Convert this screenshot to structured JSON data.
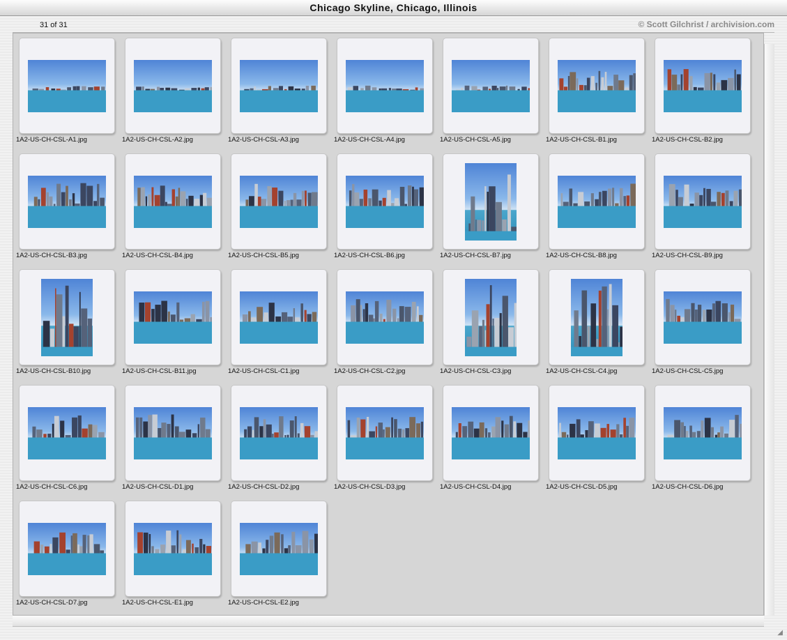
{
  "window": {
    "title": "Chicago Skyline, Chicago, Illinois"
  },
  "header": {
    "count": "31 of 31",
    "copyright": "© Scott Gilchrist / archivision.com"
  },
  "images": [
    {
      "file": "1A2-US-CH-CSL-A1.jpg",
      "orientation": "landscape"
    },
    {
      "file": "1A2-US-CH-CSL-A2.jpg",
      "orientation": "landscape"
    },
    {
      "file": "1A2-US-CH-CSL-A3.jpg",
      "orientation": "landscape"
    },
    {
      "file": "1A2-US-CH-CSL-A4.jpg",
      "orientation": "landscape"
    },
    {
      "file": "1A2-US-CH-CSL-A5.jpg",
      "orientation": "landscape"
    },
    {
      "file": "1A2-US-CH-CSL-B1.jpg",
      "orientation": "landscape"
    },
    {
      "file": "1A2-US-CH-CSL-B2.jpg",
      "orientation": "landscape"
    },
    {
      "file": "1A2-US-CH-CSL-B3.jpg",
      "orientation": "landscape"
    },
    {
      "file": "1A2-US-CH-CSL-B4.jpg",
      "orientation": "landscape"
    },
    {
      "file": "1A2-US-CH-CSL-B5.jpg",
      "orientation": "landscape"
    },
    {
      "file": "1A2-US-CH-CSL-B6.jpg",
      "orientation": "landscape"
    },
    {
      "file": "1A2-US-CH-CSL-B7.jpg",
      "orientation": "portrait"
    },
    {
      "file": "1A2-US-CH-CSL-B8.jpg",
      "orientation": "landscape"
    },
    {
      "file": "1A2-US-CH-CSL-B9.jpg",
      "orientation": "landscape"
    },
    {
      "file": "1A2-US-CH-CSL-B10.jpg",
      "orientation": "portrait"
    },
    {
      "file": "1A2-US-CH-CSL-B11.jpg",
      "orientation": "landscape"
    },
    {
      "file": "1A2-US-CH-CSL-C1.jpg",
      "orientation": "landscape"
    },
    {
      "file": "1A2-US-CH-CSL-C2.jpg",
      "orientation": "landscape"
    },
    {
      "file": "1A2-US-CH-CSL-C3.jpg",
      "orientation": "portrait"
    },
    {
      "file": "1A2-US-CH-CSL-C4.jpg",
      "orientation": "portrait"
    },
    {
      "file": "1A2-US-CH-CSL-C5.jpg",
      "orientation": "landscape"
    },
    {
      "file": "1A2-US-CH-CSL-C6.jpg",
      "orientation": "landscape"
    },
    {
      "file": "1A2-US-CH-CSL-D1.jpg",
      "orientation": "landscape"
    },
    {
      "file": "1A2-US-CH-CSL-D2.jpg",
      "orientation": "landscape"
    },
    {
      "file": "1A2-US-CH-CSL-D3.jpg",
      "orientation": "landscape"
    },
    {
      "file": "1A2-US-CH-CSL-D4.jpg",
      "orientation": "landscape"
    },
    {
      "file": "1A2-US-CH-CSL-D5.jpg",
      "orientation": "landscape"
    },
    {
      "file": "1A2-US-CH-CSL-D6.jpg",
      "orientation": "landscape"
    },
    {
      "file": "1A2-US-CH-CSL-D7.jpg",
      "orientation": "landscape"
    },
    {
      "file": "1A2-US-CH-CSL-E1.jpg",
      "orientation": "landscape"
    },
    {
      "file": "1A2-US-CH-CSL-E2.jpg",
      "orientation": "landscape"
    }
  ]
}
